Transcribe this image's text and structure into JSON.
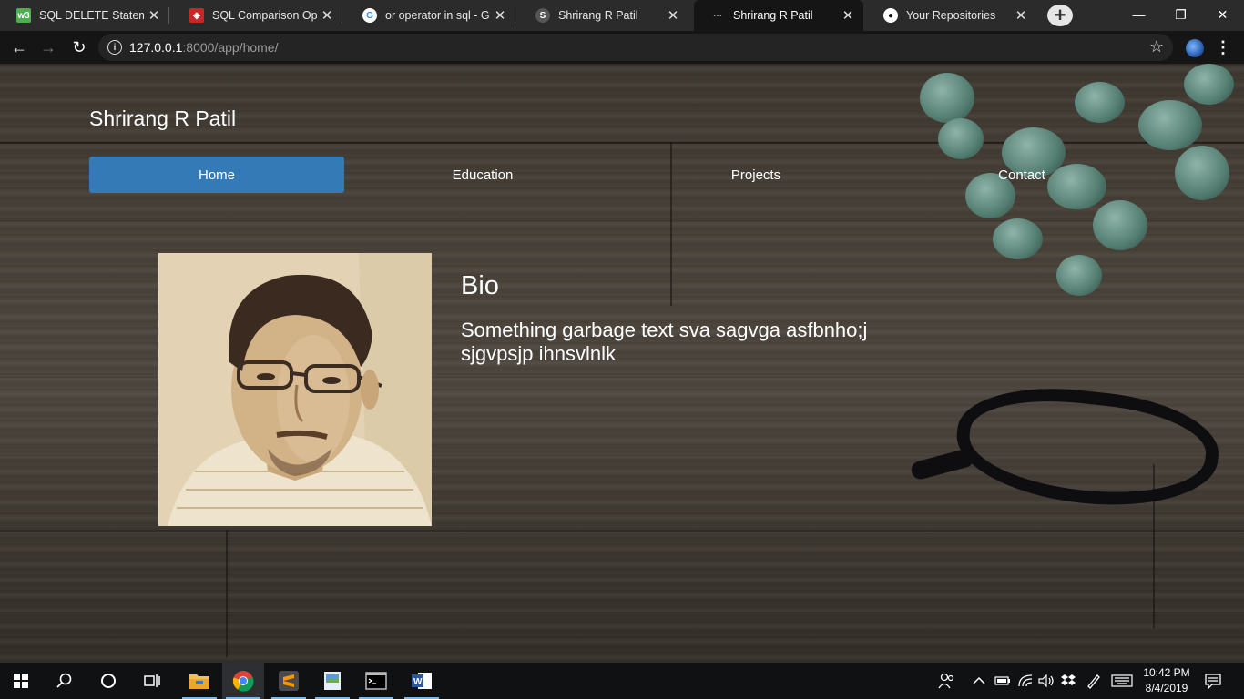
{
  "browser": {
    "tabs": [
      {
        "title": "SQL DELETE Statement",
        "favicon": "w3schools-icon",
        "color": "#4caf50",
        "glyph": "w3"
      },
      {
        "title": "SQL Comparison Opera",
        "favicon": "sql-site-icon",
        "color": "#c62828",
        "glyph": "◈"
      },
      {
        "title": "or operator in sql - Goo",
        "favicon": "google-icon",
        "color": "#ffffff",
        "glyph": "G"
      },
      {
        "title": "Shrirang R Patil",
        "favicon": "loading-icon",
        "color": "#777777",
        "glyph": "S"
      },
      {
        "title": "Shrirang R Patil",
        "favicon": "loading-icon",
        "color": "#777777",
        "glyph": "⋯"
      },
      {
        "title": "Your Repositories",
        "favicon": "github-icon",
        "color": "#ffffff",
        "glyph": "●"
      }
    ],
    "active_tab_index": 4,
    "url_host": "127.0.0.1",
    "url_rest": ":8000/app/home/"
  },
  "site": {
    "title": "Shrirang R Patil",
    "nav": [
      "Home",
      "Education",
      "Projects",
      "Contact"
    ],
    "active_nav": "Home",
    "bio_heading": "Bio",
    "bio_text": "Something garbage text sva sagvga asfbnho;j sjgvpsjp ihnsvlnlk"
  },
  "taskbar": {
    "time": "10:42 PM",
    "date": "8/4/2019"
  },
  "colors": {
    "accent": "#337ab7",
    "chrome_dark": "#151515"
  }
}
